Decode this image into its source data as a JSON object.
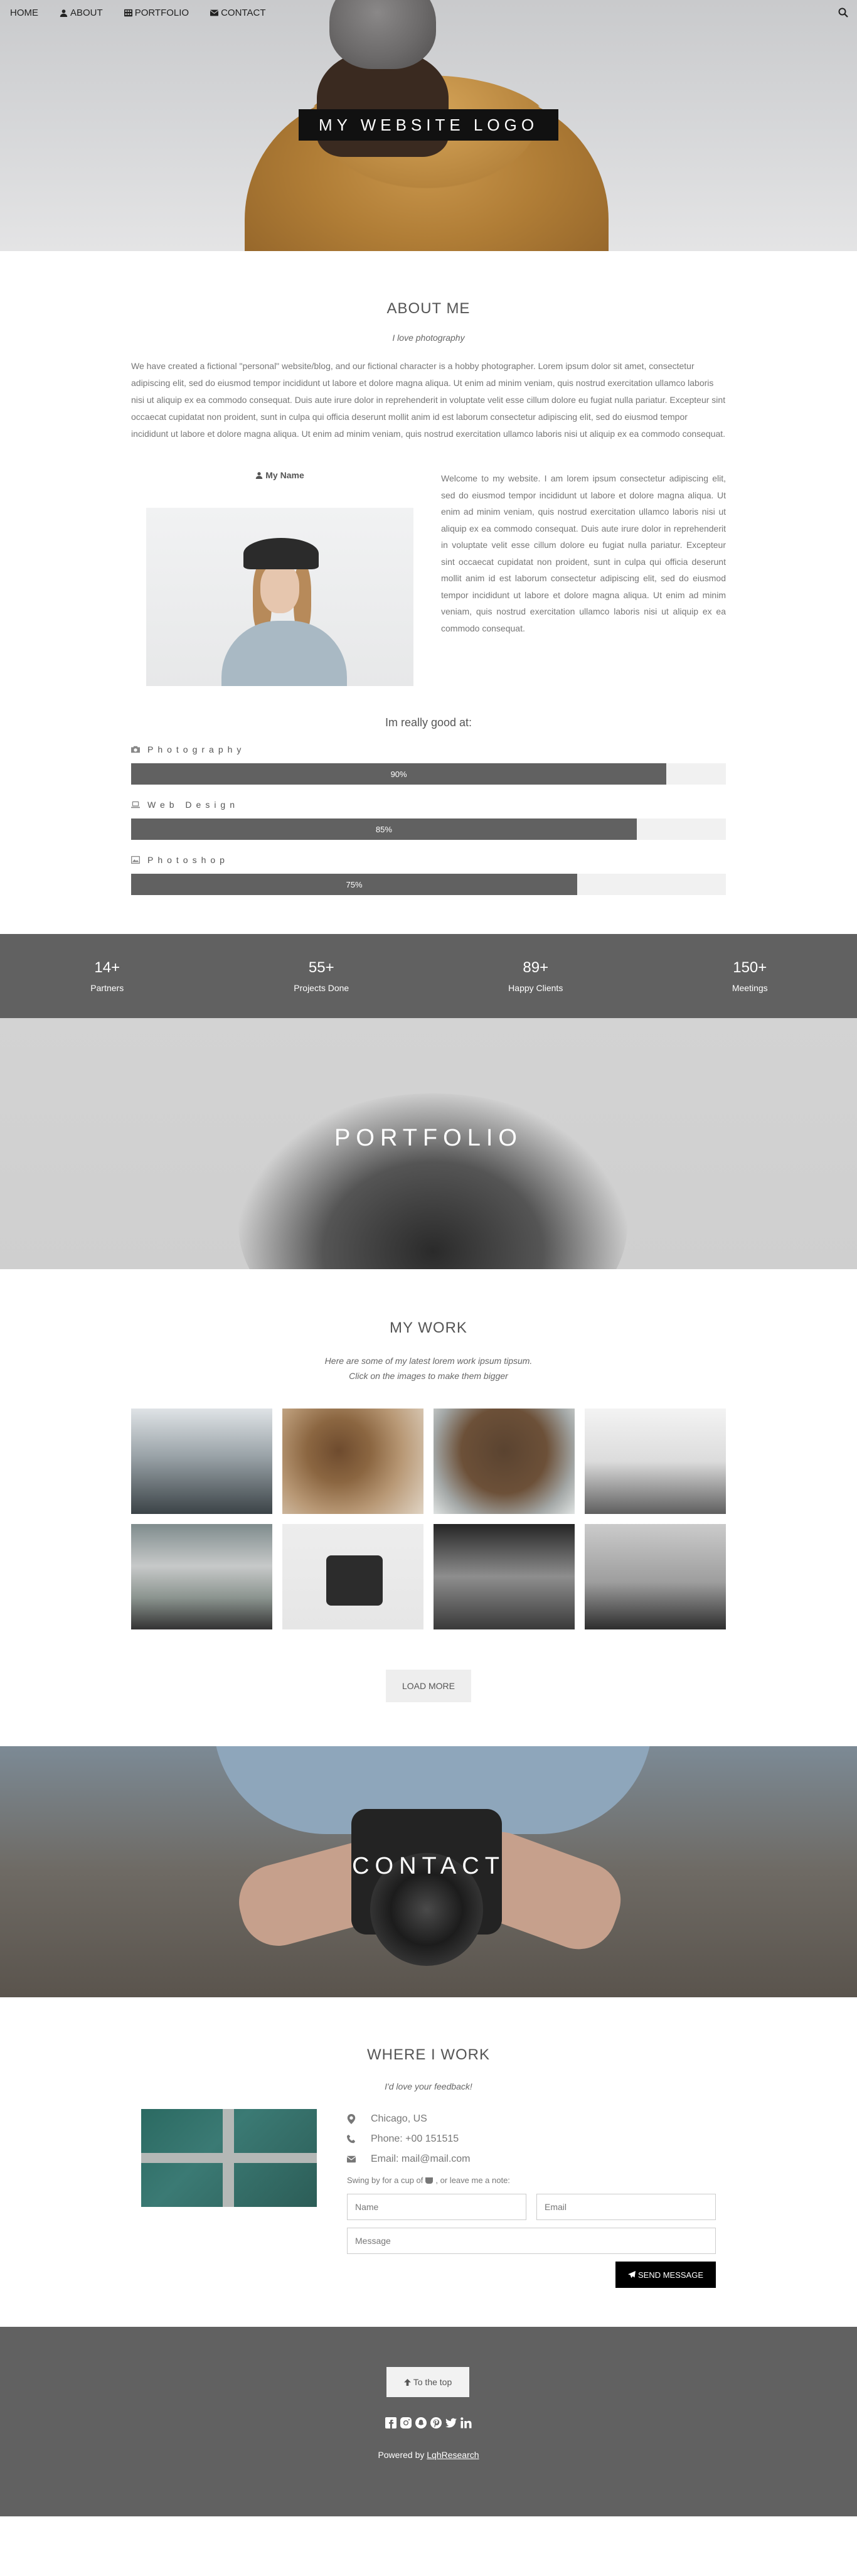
{
  "nav": {
    "home": "HOME",
    "about": "ABOUT",
    "portfolio": "PORTFOLIO",
    "contact": "CONTACT"
  },
  "hero": {
    "logo": "MY WEBSITE LOGO"
  },
  "about": {
    "title": "ABOUT ME",
    "subtitle": "I love photography",
    "paragraph": "We have created a fictional \"personal\" website/blog, and our fictional character is a hobby photographer. Lorem ipsum dolor sit amet, consectetur adipiscing elit, sed do eiusmod tempor incididunt ut labore et dolore magna aliqua. Ut enim ad minim veniam, quis nostrud exercitation ullamco laboris nisi ut aliquip ex ea commodo consequat. Duis aute irure dolor in reprehenderit in voluptate velit esse cillum dolore eu fugiat nulla pariatur. Excepteur sint occaecat cupidatat non proident, sunt in culpa qui officia deserunt mollit anim id est laborum consectetur adipiscing elit, sed do eiusmod tempor incididunt ut labore et dolore magna aliqua. Ut enim ad minim veniam, quis nostrud exercitation ullamco laboris nisi ut aliquip ex ea commodo consequat.",
    "name": "My Name",
    "welcome": "Welcome to my website. I am lorem ipsum consectetur adipiscing elit, sed do eiusmod tempor incididunt ut labore et dolore magna aliqua. Ut enim ad minim veniam, quis nostrud exercitation ullamco laboris nisi ut aliquip ex ea commodo consequat. Duis aute irure dolor in reprehenderit in voluptate velit esse cillum dolore eu fugiat nulla pariatur. Excepteur sint occaecat cupidatat non proident, sunt in culpa qui officia deserunt mollit anim id est laborum consectetur adipiscing elit, sed do eiusmod tempor incididunt ut labore et dolore magna aliqua. Ut enim ad minim veniam, quis nostrud exercitation ullamco laboris nisi ut aliquip ex ea commodo consequat."
  },
  "skills": {
    "title": "Im really good at:",
    "items": [
      {
        "label": "Photography",
        "value": 90,
        "text": "90%",
        "icon": "camera-icon"
      },
      {
        "label": "Web Design",
        "value": 85,
        "text": "85%",
        "icon": "laptop-icon"
      },
      {
        "label": "Photoshop",
        "value": 75,
        "text": "75%",
        "icon": "image-icon"
      }
    ]
  },
  "stats": [
    {
      "num": "14+",
      "label": "Partners"
    },
    {
      "num": "55+",
      "label": "Projects Done"
    },
    {
      "num": "89+",
      "label": "Happy Clients"
    },
    {
      "num": "150+",
      "label": "Meetings"
    }
  ],
  "portfolio": {
    "banner": "PORTFOLIO"
  },
  "work": {
    "title": "MY WORK",
    "line1": "Here are some of my latest lorem work ipsum tipsum.",
    "line2": "Click on the images to make them bigger",
    "load_more": "LOAD MORE"
  },
  "contact": {
    "banner": "CONTACT",
    "title": "WHERE I WORK",
    "subtitle": "I'd love your feedback!",
    "location": "Chicago, US",
    "phone": "Phone: +00 151515",
    "email": "Email: mail@mail.com",
    "swing_prefix": "Swing by for a cup of",
    "swing_suffix": ", or leave me a note:",
    "name_placeholder": "Name",
    "email_placeholder": "Email",
    "message_placeholder": "Message",
    "send": "SEND MESSAGE"
  },
  "footer": {
    "to_top": "To the top",
    "powered_prefix": "Powered by",
    "powered_link": "LqhResearch"
  },
  "colors": {
    "dark_band": "#616161",
    "bar_fill": "#616161",
    "button_dark": "#000000"
  }
}
